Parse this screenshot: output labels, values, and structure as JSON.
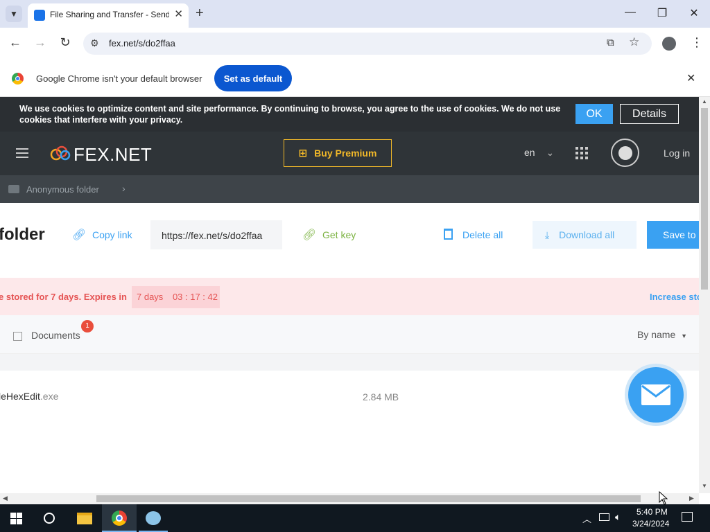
{
  "browser": {
    "tab_title": "File Sharing and Transfer - Send",
    "url": "fex.net/s/do2ffaa",
    "default_msg": "Google Chrome isn't your default browser",
    "set_default": "Set as default"
  },
  "cookie": {
    "text": "We use cookies to optimize content and site performance. By continuing to browse, you agree to the use of cookies. We do not use cookies that interfere with your privacy.",
    "ok": "OK",
    "details": "Details"
  },
  "header": {
    "logo": "FEX.NET",
    "premium": "Buy Premium",
    "lang": "en",
    "login": "Log in"
  },
  "breadcrumb": {
    "folder": "Anonymous folder"
  },
  "toolbar": {
    "title": "folder",
    "copy_link": "Copy link",
    "link_value": "https://fex.net/s/do2ffaa",
    "get_key": "Get key",
    "delete_all": "Delete all",
    "download_all": "Download all",
    "save_to": "Save to"
  },
  "expire": {
    "text": "e stored for 7 days. Expires in",
    "days": "7 days",
    "time": "03 : 17 : 42",
    "increase": "Increase sto"
  },
  "list": {
    "tab": "Documents",
    "badge": "1",
    "sort": "By name",
    "rows": [
      {
        "name": "leHexEdit",
        "ext": ".exe",
        "size": "2.84 MB"
      }
    ]
  },
  "taskbar": {
    "time": "5:40 PM",
    "date": "3/24/2024"
  }
}
